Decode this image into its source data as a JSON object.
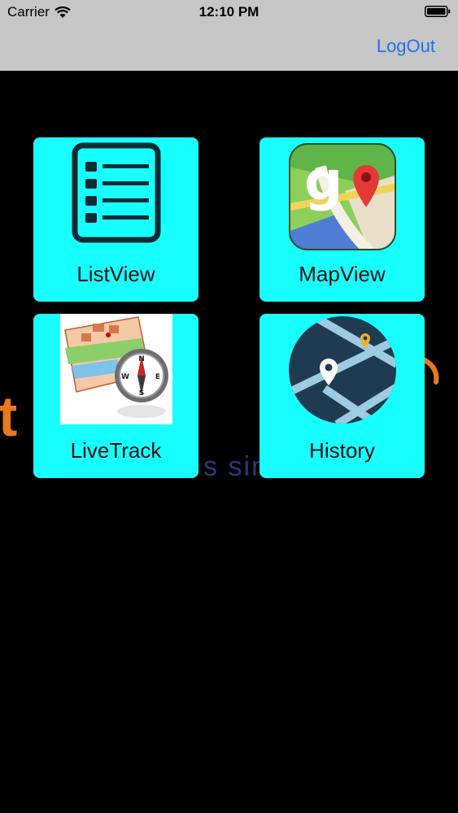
{
  "status_bar": {
    "carrier": "Carrier",
    "time": "12:10 PM",
    "wifi_icon": "wifi-icon",
    "battery_icon": "battery-icon"
  },
  "nav_bar": {
    "logout_label": "LogOut"
  },
  "tiles": [
    {
      "label": "ListView",
      "icon": "list-icon"
    },
    {
      "label": "MapView",
      "icon": "google-maps-icon"
    },
    {
      "label": "LiveTrack",
      "icon": "map-compass-icon"
    },
    {
      "label": "History",
      "icon": "route-history-icon"
    }
  ],
  "colors": {
    "tile": "#18ffff",
    "accent": "#1e73e8",
    "bar": "#c6c6c6",
    "background": "#000000"
  }
}
